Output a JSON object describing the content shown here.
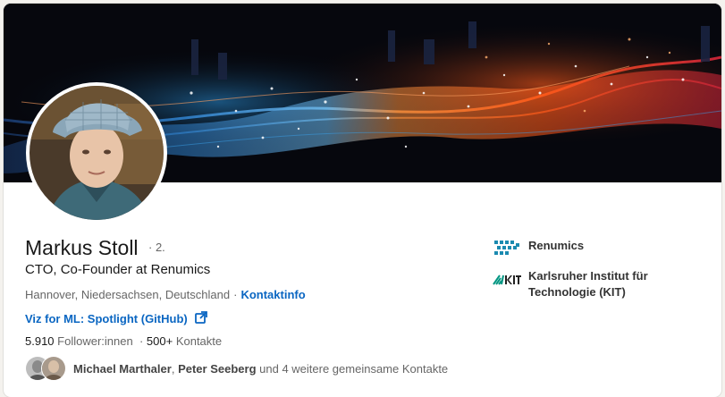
{
  "profile": {
    "name": "Markus Stoll",
    "degree": "· 2.",
    "headline": "CTO, Co-Founder at Renumics",
    "location": "Hannover, Niedersachsen, Deutschland",
    "separator": "·",
    "contact_info_label": "Kontaktinfo",
    "website_label": "Viz for ML: Spotlight (GitHub)",
    "website_icon": "external-link-icon",
    "followers_count": "5.910",
    "followers_label": "Follower:innen",
    "connections_count": "500+",
    "connections_label": "Kontakte",
    "mutual": {
      "person1": "Michael Marthaler",
      "comma": ",",
      "person2": "Peter Seeberg",
      "rest": "und 4 weitere gemeinsame Kontakte"
    }
  },
  "experience": [
    {
      "name": "Renumics",
      "icon": "renumics-logo"
    },
    {
      "name": "Karlsruher Institut für Technologie (KIT)",
      "icon": "kit-logo"
    }
  ],
  "colors": {
    "link_blue": "#0a66c2",
    "renumics_teal": "#1b8ab0",
    "kit_green": "#009682"
  }
}
